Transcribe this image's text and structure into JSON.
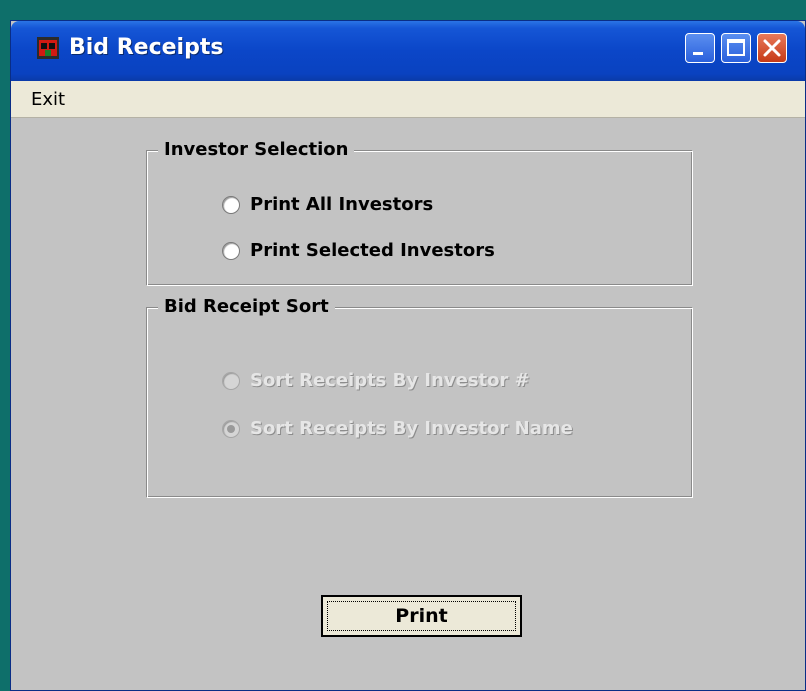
{
  "window": {
    "title": "Bid Receipts"
  },
  "menu": {
    "items": [
      "Exit"
    ]
  },
  "investor_selection": {
    "title": "Investor Selection",
    "options": [
      "Print All Investors",
      "Print Selected Investors"
    ]
  },
  "bid_receipt_sort": {
    "title": "Bid Receipt Sort",
    "options": [
      "Sort Receipts By Investor #",
      "Sort Receipts By Investor Name"
    ],
    "selected": 1,
    "enabled": false
  },
  "buttons": {
    "print": "Print"
  }
}
